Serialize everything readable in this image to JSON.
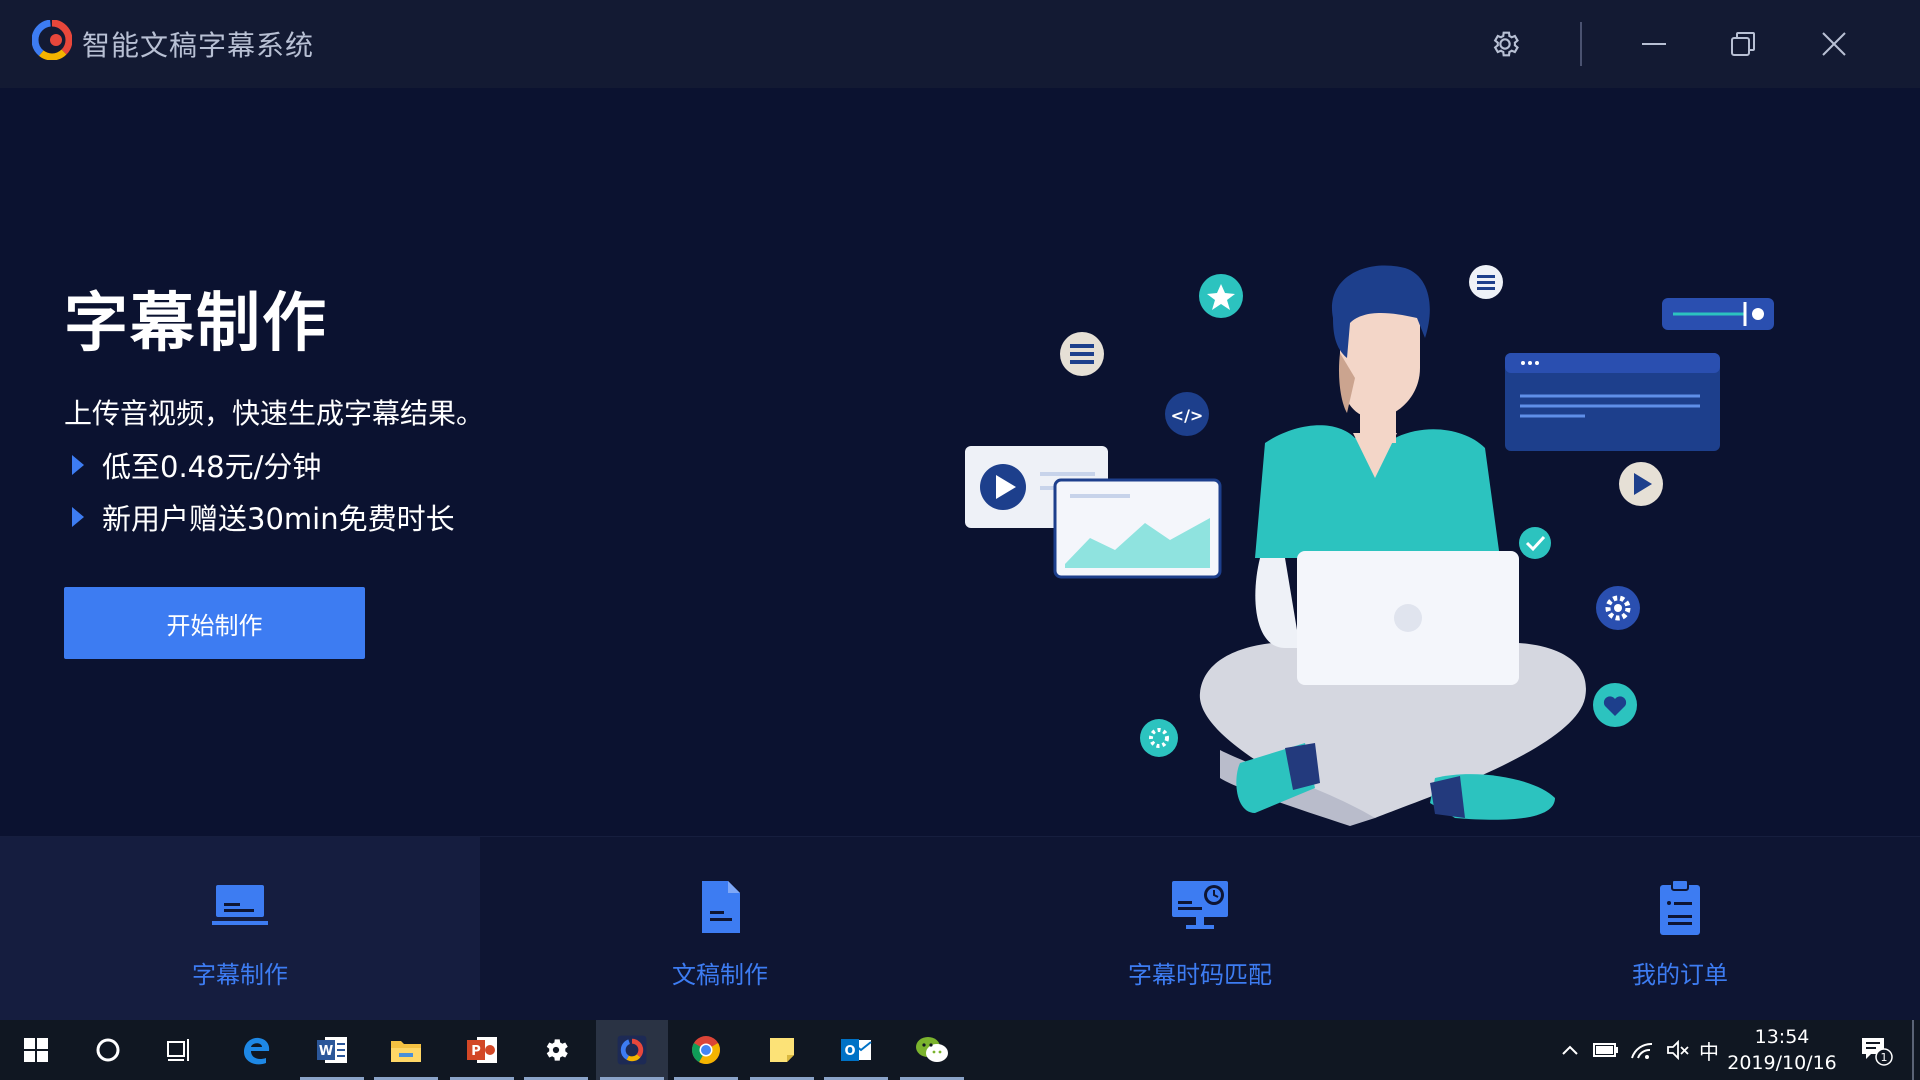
{
  "titlebar": {
    "app_title": "智能文稿字幕系统",
    "settings_icon": "gear-icon",
    "minimize_icon": "minimize-icon",
    "restore_icon": "restore-icon",
    "close_icon": "close-icon"
  },
  "hero": {
    "title": "字幕制作",
    "description": "上传音视频，快速生成字幕结果。",
    "bullets": [
      "低至0.48元/分钟",
      "新用户赠送30min免费时长"
    ],
    "cta_label": "开始制作"
  },
  "tabs": [
    {
      "label": "字幕制作",
      "icon": "subtitle-screen-icon",
      "active": true
    },
    {
      "label": "文稿制作",
      "icon": "document-icon",
      "active": false
    },
    {
      "label": "字幕时码匹配",
      "icon": "monitor-clock-icon",
      "active": false
    },
    {
      "label": "我的订单",
      "icon": "clipboard-icon",
      "active": false
    }
  ],
  "taskbar": {
    "apps": [
      "windows-start-icon",
      "cortana-search-icon",
      "task-view-icon",
      "edge-icon",
      "word-icon",
      "file-explorer-icon",
      "powerpoint-icon",
      "settings-icon",
      "subtitle-app-icon",
      "chrome-icon",
      "sticky-notes-icon",
      "outlook-icon",
      "wechat-icon"
    ],
    "tray": {
      "input_method": "中",
      "time": "13:54",
      "date": "2019/10/16",
      "notification_count": "1"
    }
  },
  "colors": {
    "accent": "#3d7cf2",
    "background": "#0b1230",
    "titlebar": "#131a33",
    "teal": "#2cc3bf"
  }
}
